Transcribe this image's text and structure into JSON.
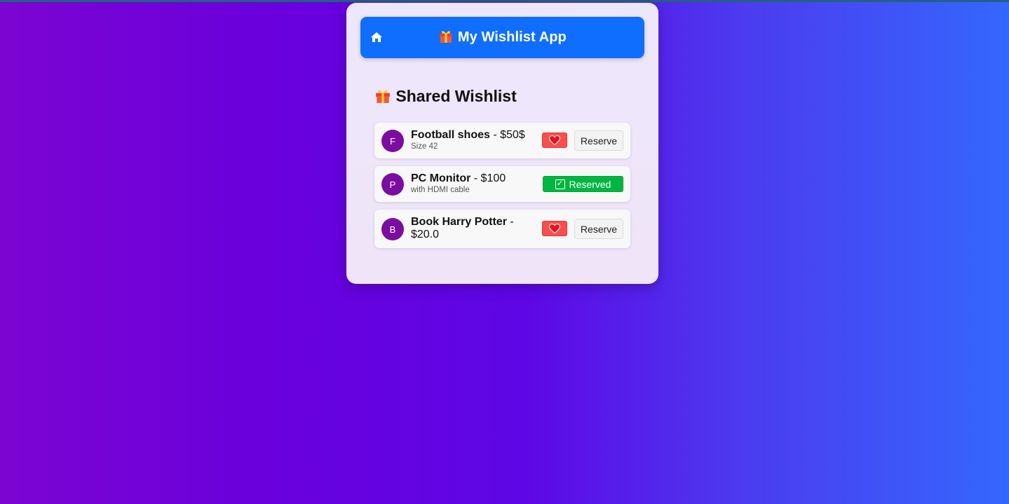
{
  "app": {
    "title": "My Wishlist App",
    "title_icon": "gift-icon",
    "home_icon": "home-icon"
  },
  "section": {
    "title": "Shared Wishlist",
    "title_icon": "gift-icon"
  },
  "buttons": {
    "reserve_label": "Reserve",
    "reserved_label": "Reserved",
    "like_icon": "heart-icon"
  },
  "items": [
    {
      "initial": "F",
      "name": "Football shoes",
      "price_text": " - $50$",
      "note": "Size 42",
      "reserved": false
    },
    {
      "initial": "P",
      "name": "PC Monitor",
      "price_text": " - $100",
      "note": "with HDMI cable",
      "reserved": true
    },
    {
      "initial": "B",
      "name": "Book Harry Potter",
      "price_text": " - $20.0",
      "note": "",
      "reserved": false
    }
  ],
  "colors": {
    "navbar": "#0f6efd",
    "avatar": "#7b0da1",
    "heart_button": "#fa4e4e",
    "reserved_badge": "#00b640"
  }
}
